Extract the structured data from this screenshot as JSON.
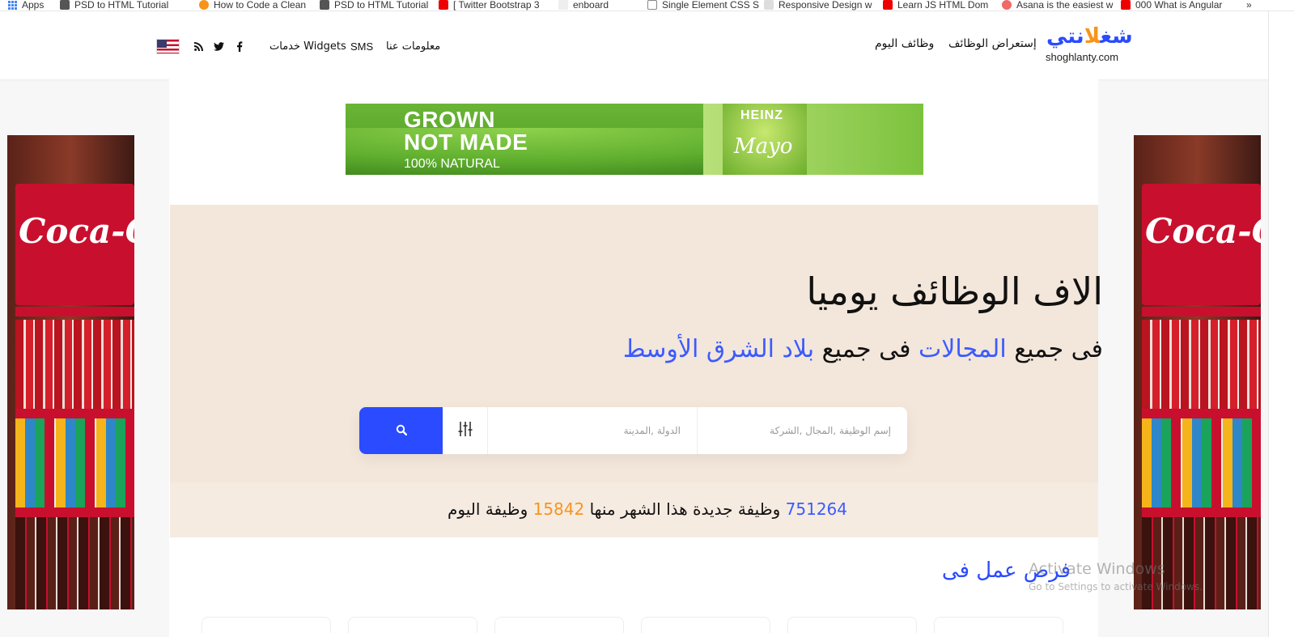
{
  "bookmarks": [
    {
      "label": "Apps"
    },
    {
      "label": "PSD to HTML Tutorial"
    },
    {
      "label": "How to Code a Clean"
    },
    {
      "label": "PSD to HTML Tutorial"
    },
    {
      "label": "[ Twitter Bootstrap 3"
    },
    {
      "label": "enboard"
    },
    {
      "label": "Single Element CSS S"
    },
    {
      "label": "Responsive Design w"
    },
    {
      "label": "Learn JS HTML Dom"
    },
    {
      "label": "Asana is the easiest w"
    },
    {
      "label": "000 What is Angular"
    },
    {
      "label": "»"
    }
  ],
  "header": {
    "logo_ar_main": "شغ",
    "logo_ar_accent": "لا",
    "logo_ar_end": "نتي",
    "logo_en": "shoghlanty.com",
    "nav_right": [
      "إستعراض الوظائف",
      "وظائف اليوم"
    ],
    "nav_left": [
      "معلومات عنا",
      "SMS",
      "خدمات Widgets"
    ],
    "social_icons": [
      "facebook-icon",
      "twitter-icon",
      "rss-icon"
    ],
    "language_flag": "us-flag"
  },
  "banner": {
    "line1": "GROWN",
    "line2": "NOT MADE",
    "line3": "100% NATURAL",
    "brand": "HEINZ",
    "product": "Mayo"
  },
  "side_ads": {
    "brand": "Coca-Cola"
  },
  "hero": {
    "title": "الاف الوظائف يوميا",
    "sub_p1": "فى جميع ",
    "sub_p2": "المجالات",
    "sub_p3": " فى جميع ",
    "sub_p4": "بلاد الشرق الأوسط"
  },
  "search": {
    "keyword_placeholder": "إسم الوظيفة ,المجال ,الشركة",
    "location_placeholder": "الدولة ,المدينة",
    "filter_icon": "sliders-icon",
    "submit_icon": "search-icon"
  },
  "stats": {
    "month_count": "751264",
    "month_text": " وظيفة جديدة هذا الشهر منها ",
    "today_count": "15842",
    "today_text": " وظيفة اليوم"
  },
  "jobs_heading": "فرص عمل فى",
  "watermark": {
    "line1": "Activate Windows",
    "line2": "Go to Settings to activate Windows."
  },
  "colors": {
    "brand_blue": "#2a4bff",
    "brand_orange": "#f7941d",
    "hero_bg": "#f3e6da"
  }
}
